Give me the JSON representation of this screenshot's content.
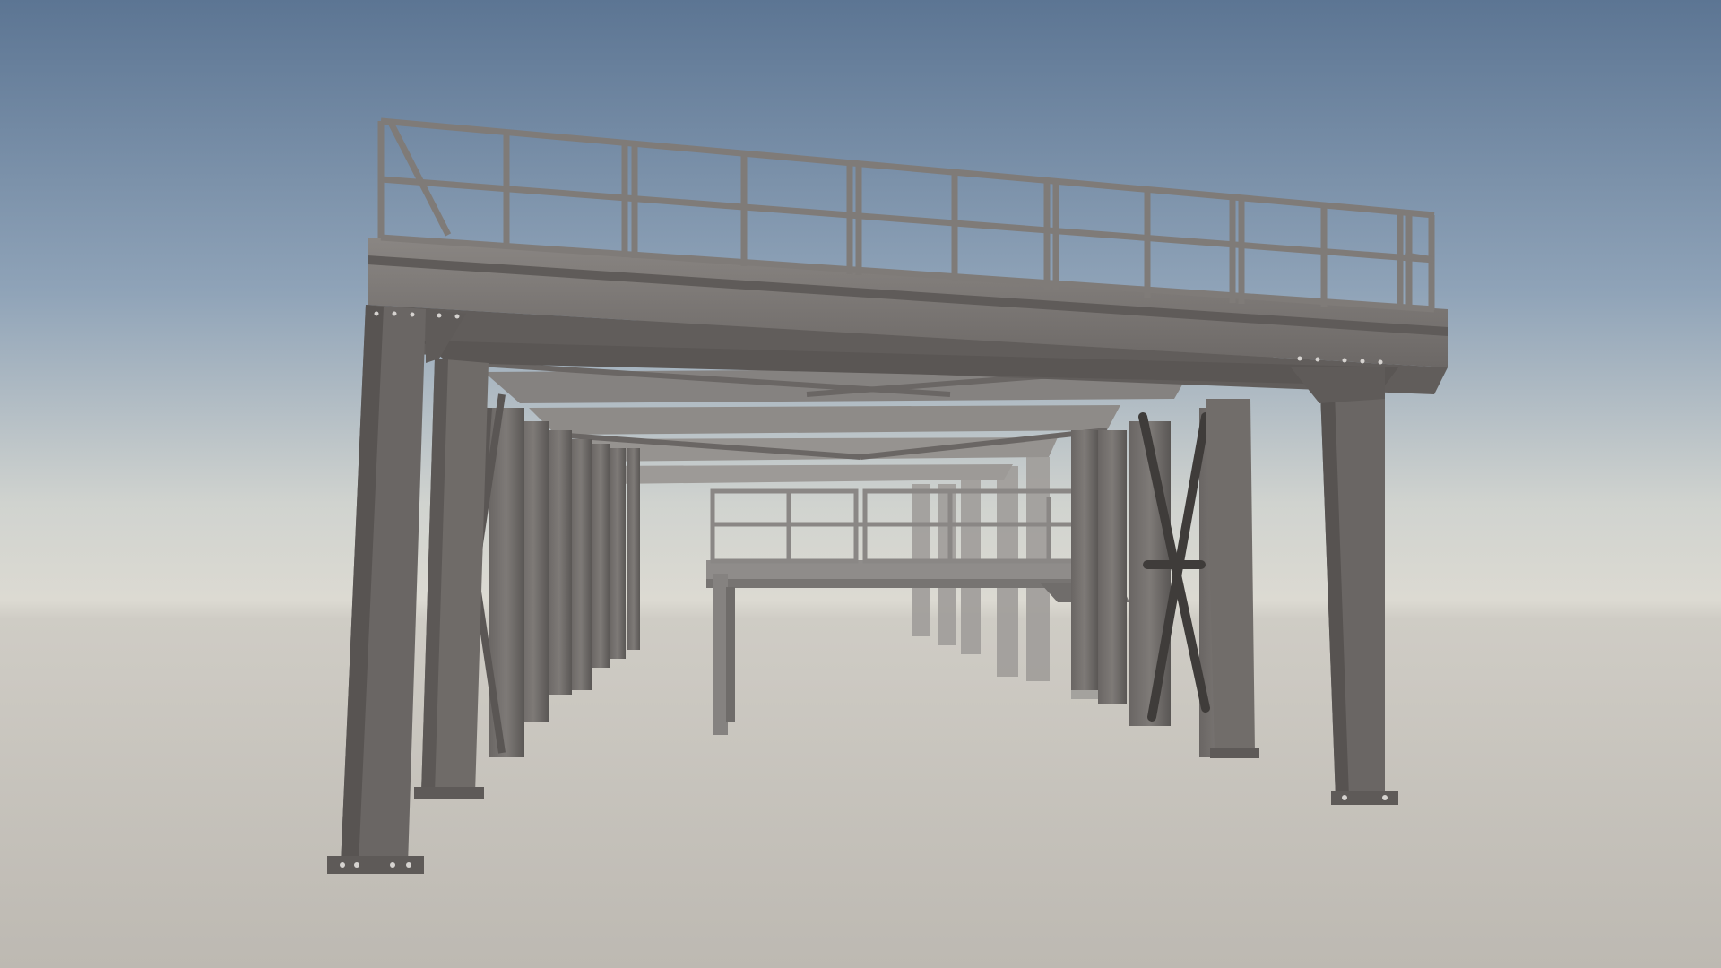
{
  "scene": {
    "subject": "steel-platform-structure",
    "colors": {
      "sky_top": "#5c7593",
      "sky_mid": "#8fa3b8",
      "horizon": "#dcdad2",
      "ground": "#bdb9b2",
      "steel_dark": "#4d4a48",
      "steel_mid": "#6e6a67",
      "steel_light": "#8f8b88",
      "steel_far": "#a7a4a2",
      "bolt": "#d6d3d0"
    }
  }
}
